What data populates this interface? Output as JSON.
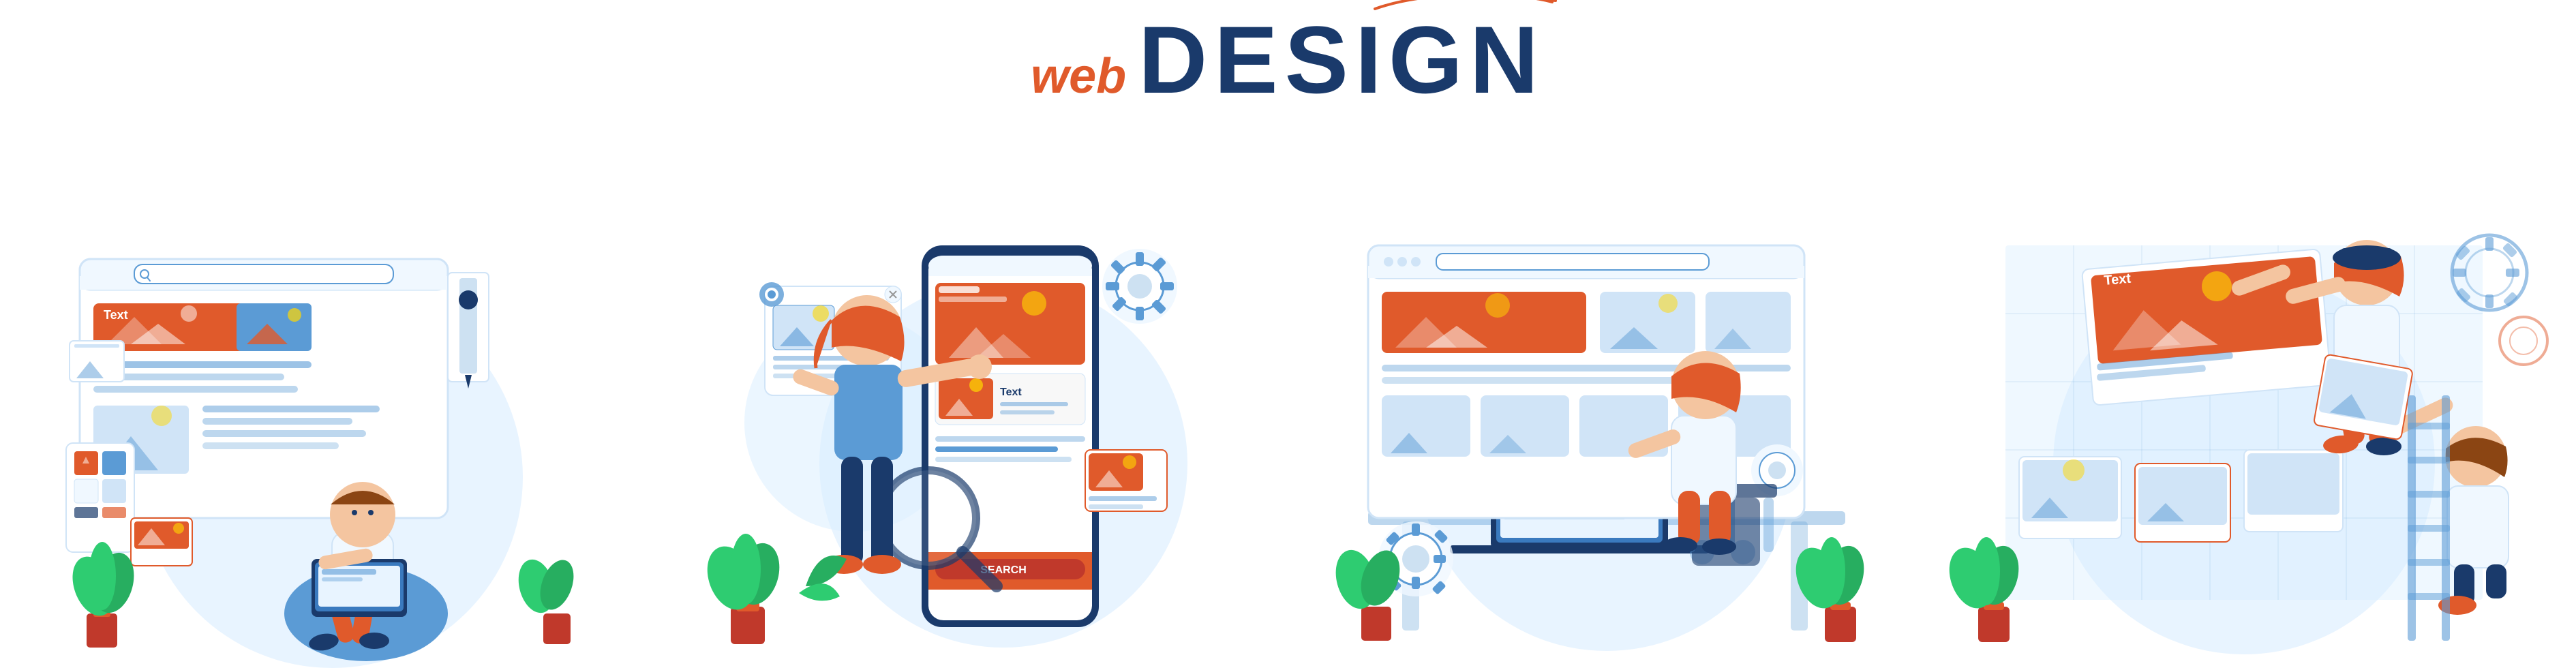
{
  "header": {
    "web_label": "web",
    "design_label": "DESIGN",
    "curve_decoration": true
  },
  "panels": [
    {
      "id": "panel1",
      "description": "Developer working on laptop with web browser UI",
      "text_labels": [
        "Text"
      ],
      "has_browser": true,
      "has_palette": true,
      "has_person": true,
      "has_plant": true
    },
    {
      "id": "panel2",
      "description": "Woman interacting with mobile app UI on smartphone",
      "text_labels": [
        "Text"
      ],
      "has_phone": true,
      "has_person": true,
      "has_plant": true,
      "search_label": "SEARCH"
    },
    {
      "id": "panel3",
      "description": "Woman at desk working on web design with gear icons",
      "text_labels": [],
      "has_browser": true,
      "has_person": true,
      "has_plant": true,
      "has_gears": true
    },
    {
      "id": "panel4",
      "description": "Team placing UI elements on large web layout",
      "text_labels": [
        "Text"
      ],
      "has_browser": true,
      "has_gears": true,
      "has_ladder": true,
      "has_plant": true
    }
  ],
  "colors": {
    "orange": "#e05a2b",
    "blue_dark": "#1a3a6b",
    "blue_mid": "#5b9bd5",
    "blue_light": "#d0e4f7",
    "bg_circle": "#e8f4ff",
    "white": "#ffffff"
  }
}
